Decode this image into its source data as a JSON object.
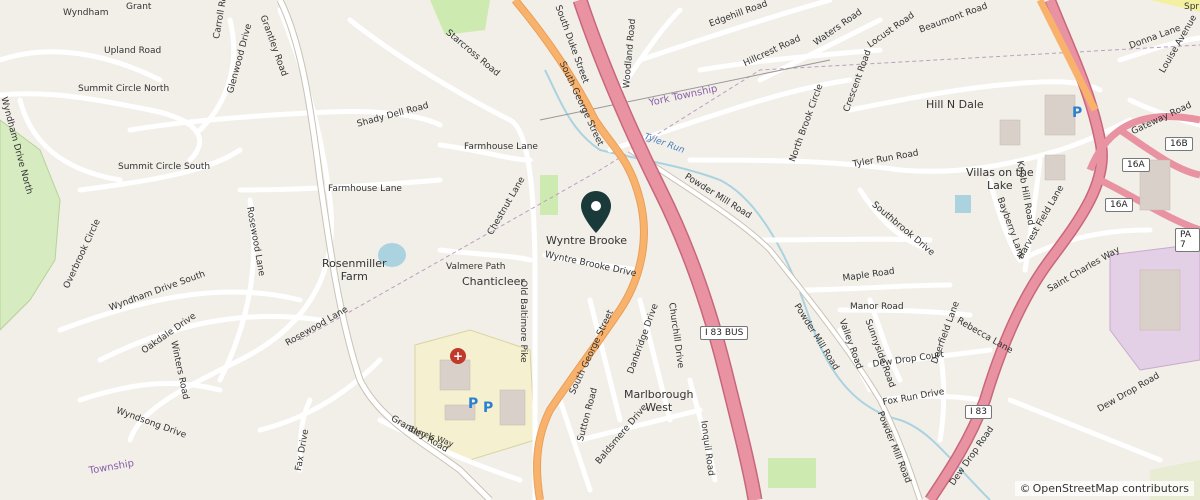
{
  "attribution": {
    "symbol": "©",
    "text": "OpenStreetMap contributors"
  },
  "colors": {
    "background": "#f2efe9",
    "motorway": "#e892a2",
    "trunk": "#f9b26b",
    "minor_road": "#ffffff",
    "water": "#aad3df",
    "park": "#cdebb0",
    "hospital": "#f5f1d0",
    "industrial": "#e3cfe6",
    "pin": "#1a3a3a"
  },
  "icons": {
    "pin": "map-pin-icon",
    "hospital": "hospital-icon",
    "parking": "parking-icon"
  },
  "places": {
    "rosenmiller_farm": "Rosenmiller\nFarm",
    "chanticleer": "Chanticleer",
    "wyntre_brooke": "Wyntre Brooke",
    "marlborough_west": "Marlborough\nWest",
    "hill_n_dale": "Hill N Dale",
    "villas_on_the_lake": "Villas on the\nLake"
  },
  "townships": {
    "york_township": "York Township",
    "township_bottom": "Township"
  },
  "water": {
    "tyler_run": "Tyler Run"
  },
  "shields": {
    "i83_bus": "I 83 BUS",
    "i83": "I 83",
    "pa7": "PA 7",
    "exit16a": "16A",
    "exit16b": "16B",
    "exit16a_2": "16A"
  },
  "parking": {
    "p": "P"
  },
  "roads": {
    "wyndham": "Wyndham",
    "grant": "Grant",
    "carroll_road": "Carroll Road",
    "grantley_road_top": "Grantley Road",
    "starcross_road": "Starcross Road",
    "south_duke_street": "South Duke Street",
    "south_george_street_top": "South George Street",
    "woodland_road": "Woodland Road",
    "edgehill_road": "Edgehill Road",
    "hillcrest_road": "Hillcrest Road",
    "waters_road": "Waters Road",
    "locust_road": "Locust Road",
    "beaumont_road": "Beaumont Road",
    "donna_lane": "Donna Lane",
    "louise_avenue": "Louise Avenue",
    "gateway_road": "Gateway Road",
    "upland_road": "Upland Road",
    "glenwood_drive": "Glenwood Drive",
    "summit_circle_north": "Summit Circle North",
    "wyndham_drive_north": "Wyndham Drive North",
    "shady_dell_road": "Shady Dell Road",
    "crescent_road": "Crescent Road",
    "north_brook_circle": "North Brook Circle",
    "farmhouse_lane_1": "Farmhouse Lane",
    "farmhouse_lane_2": "Farmhouse Lane",
    "summit_circle_south": "Summit Circle South",
    "chestnut_lane": "Chestnut Lane",
    "powder_mill_road_1": "Powder Mill Road",
    "tyler_run_road": "Tyler Run Road",
    "knob_hill_road": "Knob Hill Road",
    "southbrook_drive": "Southbrook Drive",
    "bayberry_lane": "Bayberry Lane",
    "harvest_field_lane": "Harvest Field Lane",
    "rosewood_lane_1": "Rosewood Lane",
    "overbrook_circle": "Overbrook Circle",
    "valmere_path": "Valmere Path",
    "wyntre_brooke_drive": "Wyntre Brooke Drive",
    "saint_charles_way": "Saint Charles Way",
    "maple_road": "Maple Road",
    "wyndham_drive_south": "Wyndham Drive South",
    "oakdale_drive": "Oakdale Drive",
    "winters_road": "Winters Road",
    "rosewood_lane_2": "Rosewood Lane",
    "old_baltimore_pike": "Old Baltimore Pike",
    "south_george_street_bottom": "South George Street",
    "danbridge_drive": "Danbridge Drive",
    "churchill_drive": "Churchill Drive",
    "manor_road": "Manor Road",
    "valley_road": "Valley Road",
    "powder_mill_road_2": "Powder Mill Road",
    "sunnyside_road": "Sunnyside Road",
    "rebecca_lane": "Rebecca Lane",
    "dew_drop_court": "Dew Drop Court",
    "deerfield_lane": "Deerfield Lane",
    "fox_run_drive": "Fox Run Drive",
    "dew_drop_road_1": "Dew Drop Road",
    "wyndsong_drive": "Wyndsong Drive",
    "grantley_road_bottom": "Grantley Road",
    "barrels_way": "Barrels Way",
    "sutton_road": "Sutton Road",
    "baldsmere_drive": "Baldsmere Drive",
    "ionquil_road": "Ionquil Road",
    "powder_mill_road_3": "Powder Mill Road",
    "dew_drop_road_2": "Dew Drop Road",
    "fax_drive": "Fax Drive",
    "spr": "Spr"
  }
}
